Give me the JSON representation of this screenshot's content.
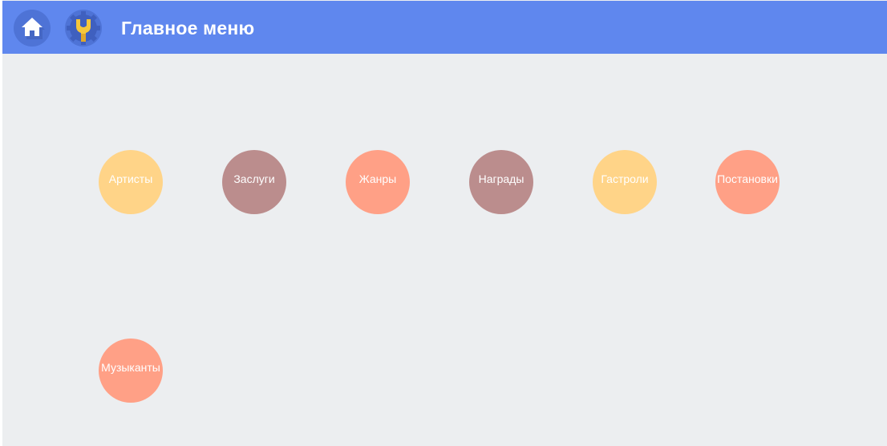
{
  "header": {
    "title": "Главное меню",
    "home_icon": "home-icon",
    "settings_icon": "settings-wrench-icon"
  },
  "menu": {
    "items": [
      {
        "label": "Артисты",
        "color": "#ffd488"
      },
      {
        "label": "Заслуги",
        "color": "#bb8d8d"
      },
      {
        "label": "Жанры",
        "color": "#ffa086"
      },
      {
        "label": "Награды",
        "color": "#bb8d8d"
      },
      {
        "label": "Гастроли",
        "color": "#ffd488"
      },
      {
        "label": "Постановки",
        "color": "#ffa086"
      },
      {
        "label": "Музыканты",
        "color": "#ffa086"
      }
    ]
  },
  "colors": {
    "header": "#5f87ee",
    "background": "#eceef0"
  }
}
